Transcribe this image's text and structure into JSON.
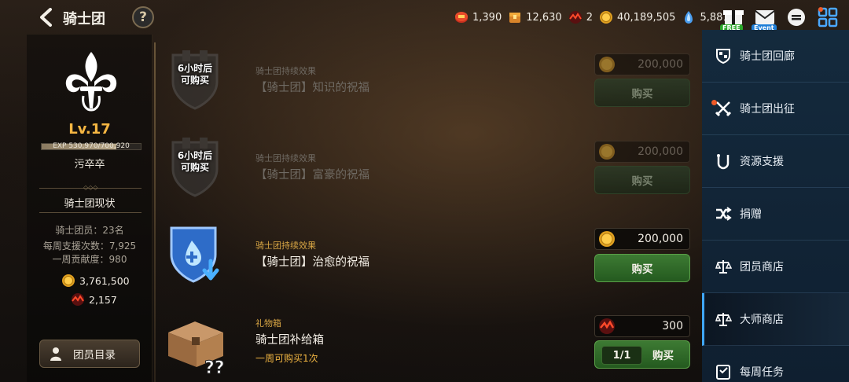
{
  "header": {
    "title": "骑士团",
    "help": "?"
  },
  "currencies": [
    {
      "icon": "red-coin-icon",
      "value": "1,390"
    },
    {
      "icon": "treasure-crate-icon",
      "value": "12,630"
    },
    {
      "icon": "crimson-shard-icon",
      "value": "2"
    },
    {
      "icon": "gold-coin-icon",
      "value": "40,189,505"
    },
    {
      "icon": "blue-crystal-icon",
      "value": "5,881"
    }
  ],
  "top_icons": {
    "free_badge": "FREE",
    "event_badge": "Event"
  },
  "guild": {
    "level": "Lv.17",
    "exp_text": "EXP 530,970/700,920",
    "exp_fraction": 0.7575,
    "name": "污卒卒",
    "status_title": "骑士团现状",
    "stats": [
      "骑士团员：23名",
      "每周支援次数：7,925",
      "一周贡献度：980"
    ],
    "gold": "3,761,500",
    "crystal": "2,157",
    "member_button": "团员目录"
  },
  "shop_items": [
    {
      "timer_line1": "6小时后",
      "timer_line2": "可购买",
      "category": "骑士团持续效果",
      "name": "【骑士团】知识的祝福",
      "price": "200,000",
      "buy_label": "购买",
      "state": "disabled"
    },
    {
      "timer_line1": "6小时后",
      "timer_line2": "可购买",
      "category": "骑士团持续效果",
      "name": "【骑士团】富豪的祝福",
      "price": "200,000",
      "buy_label": "购买",
      "state": "disabled"
    },
    {
      "category": "骑士团持续效果",
      "name": "【骑士团】治愈的祝福",
      "price": "200,000",
      "buy_label": "购买",
      "state": "active"
    },
    {
      "category": "礼物箱",
      "name": "骑士团补给箱",
      "subtext": "一周可购买1次",
      "price": "300",
      "buy_label": "购买",
      "limit": "1/1",
      "state": "active"
    }
  ],
  "nav": [
    {
      "label": "骑士团回廊",
      "icon": "gallery-shield-icon"
    },
    {
      "label": "骑士团出征",
      "icon": "crossed-swords-icon",
      "alert": true
    },
    {
      "label": "资源支援",
      "icon": "support-hands-icon"
    },
    {
      "label": "捐赠",
      "icon": "shuffle-arrows-icon"
    },
    {
      "label": "团员商店",
      "icon": "scales-shop-icon"
    },
    {
      "label": "大师商店",
      "icon": "master-scales-icon",
      "selected": true
    },
    {
      "label": "每周任务",
      "icon": "weekly-mission-icon"
    }
  ],
  "colors": {
    "accent_gold": "#f5b642",
    "buy_green": "#3d7a33",
    "nav_blue": "#142a3d",
    "selected_blue": "#3fa6ff"
  }
}
